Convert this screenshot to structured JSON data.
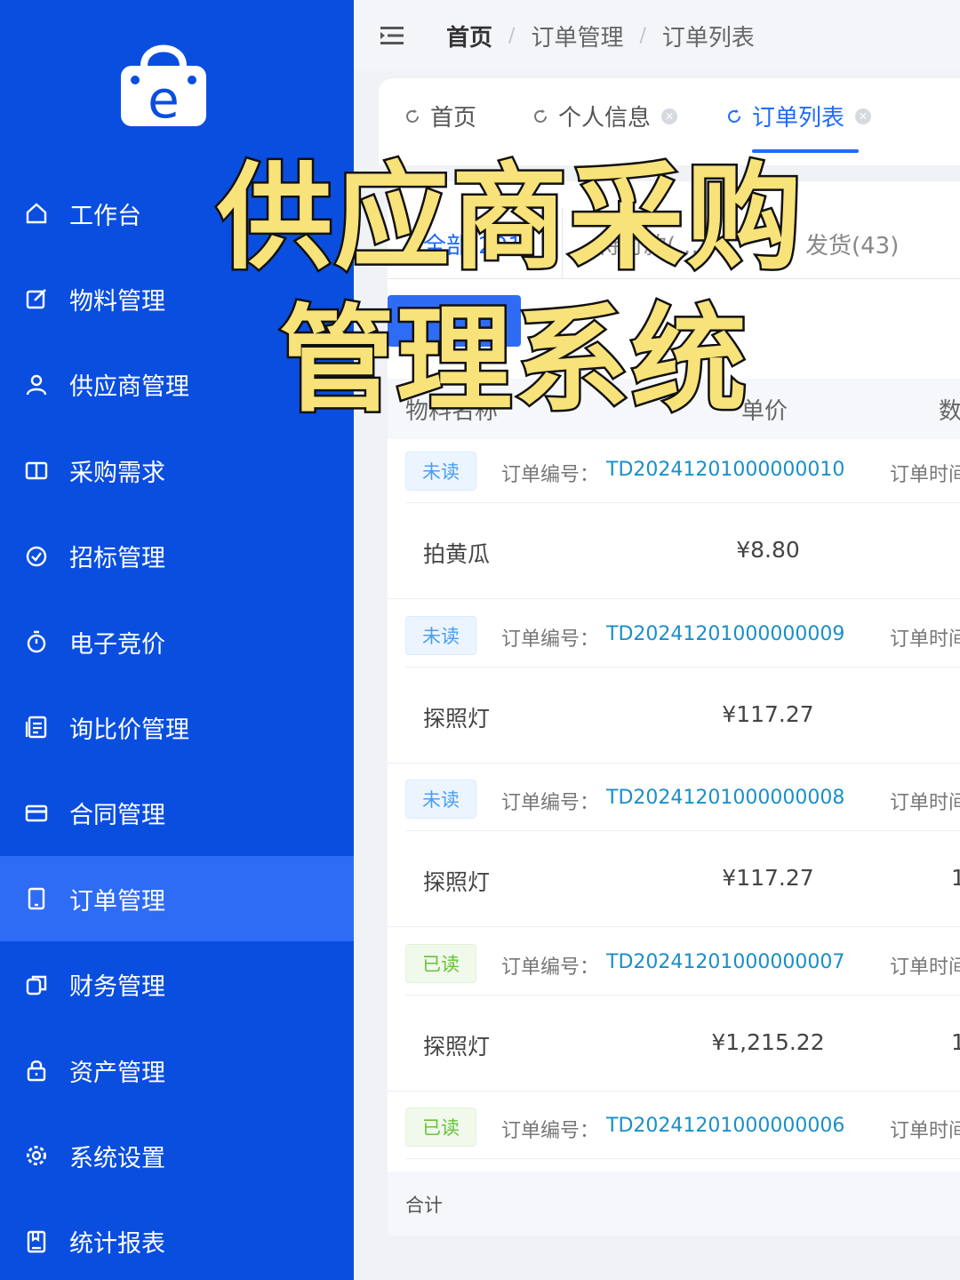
{
  "overlay": {
    "line1": "供应商采购",
    "line2": "管理系统"
  },
  "sidebar": {
    "items": [
      {
        "label": "工作台",
        "icon": "home-icon"
      },
      {
        "label": "物料管理",
        "icon": "edit-icon"
      },
      {
        "label": "供应商管理",
        "icon": "user-icon"
      },
      {
        "label": "采购需求",
        "icon": "book-icon"
      },
      {
        "label": "招标管理",
        "icon": "check-circle-icon"
      },
      {
        "label": "电子竞价",
        "icon": "timer-icon"
      },
      {
        "label": "询比价管理",
        "icon": "document-icon"
      },
      {
        "label": "合同管理",
        "icon": "card-icon"
      },
      {
        "label": "订单管理",
        "icon": "tablet-icon"
      },
      {
        "label": "财务管理",
        "icon": "copy-icon"
      },
      {
        "label": "资产管理",
        "icon": "lock-icon"
      },
      {
        "label": "系统设置",
        "icon": "gear-icon"
      },
      {
        "label": "统计报表",
        "icon": "report-icon"
      }
    ],
    "active_index": 8,
    "bg_color": "#0a4ee0",
    "active_color": "#2f6cf5"
  },
  "breadcrumb": {
    "home": "首页",
    "section": "订单管理",
    "page": "订单列表",
    "sep": "/"
  },
  "tabs": [
    {
      "label": "首页",
      "closable": false
    },
    {
      "label": "个人信息",
      "closable": true
    },
    {
      "label": "订单列表",
      "closable": true,
      "active": true
    }
  ],
  "subtabs": {
    "first": "全部(201)",
    "second": "待付款(…)",
    "third": "发货(43)"
  },
  "table": {
    "columns": {
      "name": "物料名称",
      "price": "单价",
      "qty": "数"
    },
    "order_label": "订单编号：",
    "time_label": "订单时间",
    "orders": [
      {
        "status": "未读",
        "read": false,
        "order_no": "TD20241201000000010",
        "item": "拍黄瓜",
        "price": "¥8.80",
        "qty": ""
      },
      {
        "status": "未读",
        "read": false,
        "order_no": "TD20241201000000009",
        "item": "探照灯",
        "price": "¥117.27",
        "qty": ""
      },
      {
        "status": "未读",
        "read": false,
        "order_no": "TD20241201000000008",
        "item": "探照灯",
        "price": "¥117.27",
        "qty": "1"
      },
      {
        "status": "已读",
        "read": true,
        "order_no": "TD20241201000000007",
        "item": "探照灯",
        "price": "¥1,215.22",
        "qty": "1"
      },
      {
        "status": "已读",
        "read": true,
        "order_no": "TD20241201000000006",
        "item": "",
        "price": "",
        "qty": ""
      }
    ],
    "footer": "合计"
  }
}
